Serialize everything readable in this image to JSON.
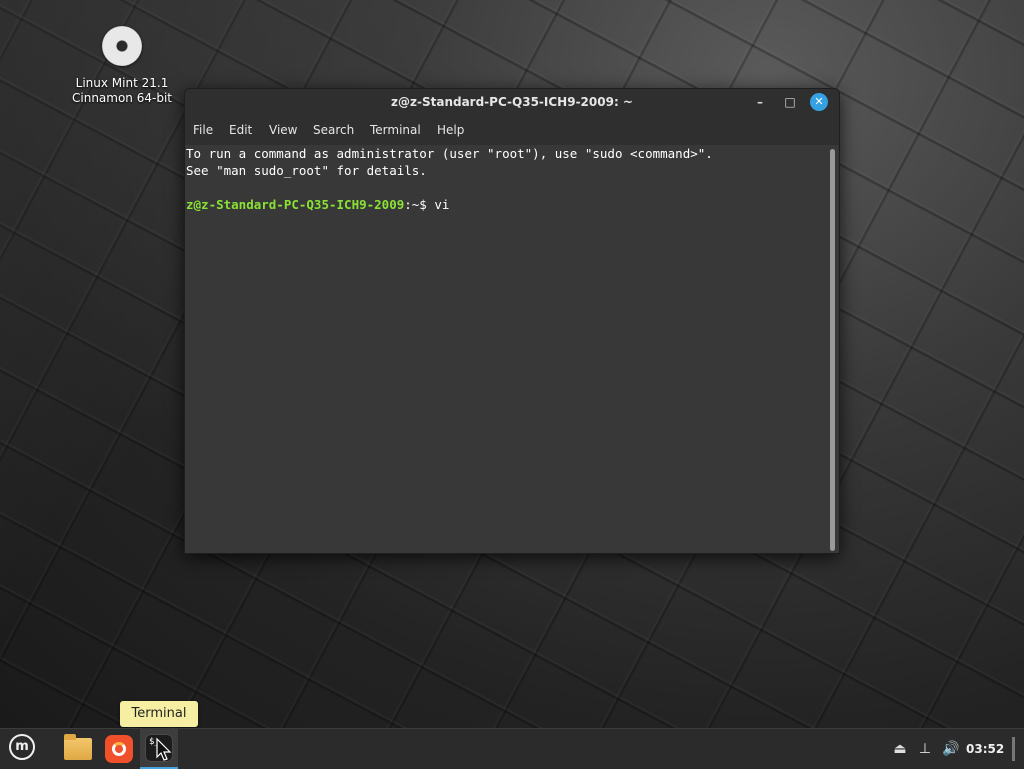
{
  "desktop": {
    "icon": {
      "line1": "Linux Mint 21.1",
      "line2": "Cinnamon 64-bit",
      "icon": "disc-icon"
    }
  },
  "terminal": {
    "title": "z@z-Standard-PC-Q35-ICH9-2009: ~",
    "menu": [
      "File",
      "Edit",
      "View",
      "Search",
      "Terminal",
      "Help"
    ],
    "lines": [
      "To run a command as administrator (user \"root\"), use \"sudo <command>\".",
      "See \"man sudo_root\" for details."
    ],
    "prompt": {
      "user_host": "z@z-Standard-PC-Q35-ICH9-2009",
      "path": ":~$ ",
      "command": "vi"
    },
    "buttons": {
      "minimize": "–",
      "maximize": "□",
      "close": "✕"
    }
  },
  "panel": {
    "tooltip": "Terminal",
    "clock": "03:52",
    "icons": {
      "menu": "mint-menu-icon",
      "files": "folder-icon",
      "firefox": "firefox-icon",
      "terminal": "terminal-icon",
      "tray": [
        "keyboard-layout-icon",
        "network-icon",
        "volume-icon"
      ]
    }
  },
  "colors": {
    "accent": "#35a1e2",
    "prompt_user": "#8ae234",
    "tooltip_bg": "#f6eea2"
  }
}
